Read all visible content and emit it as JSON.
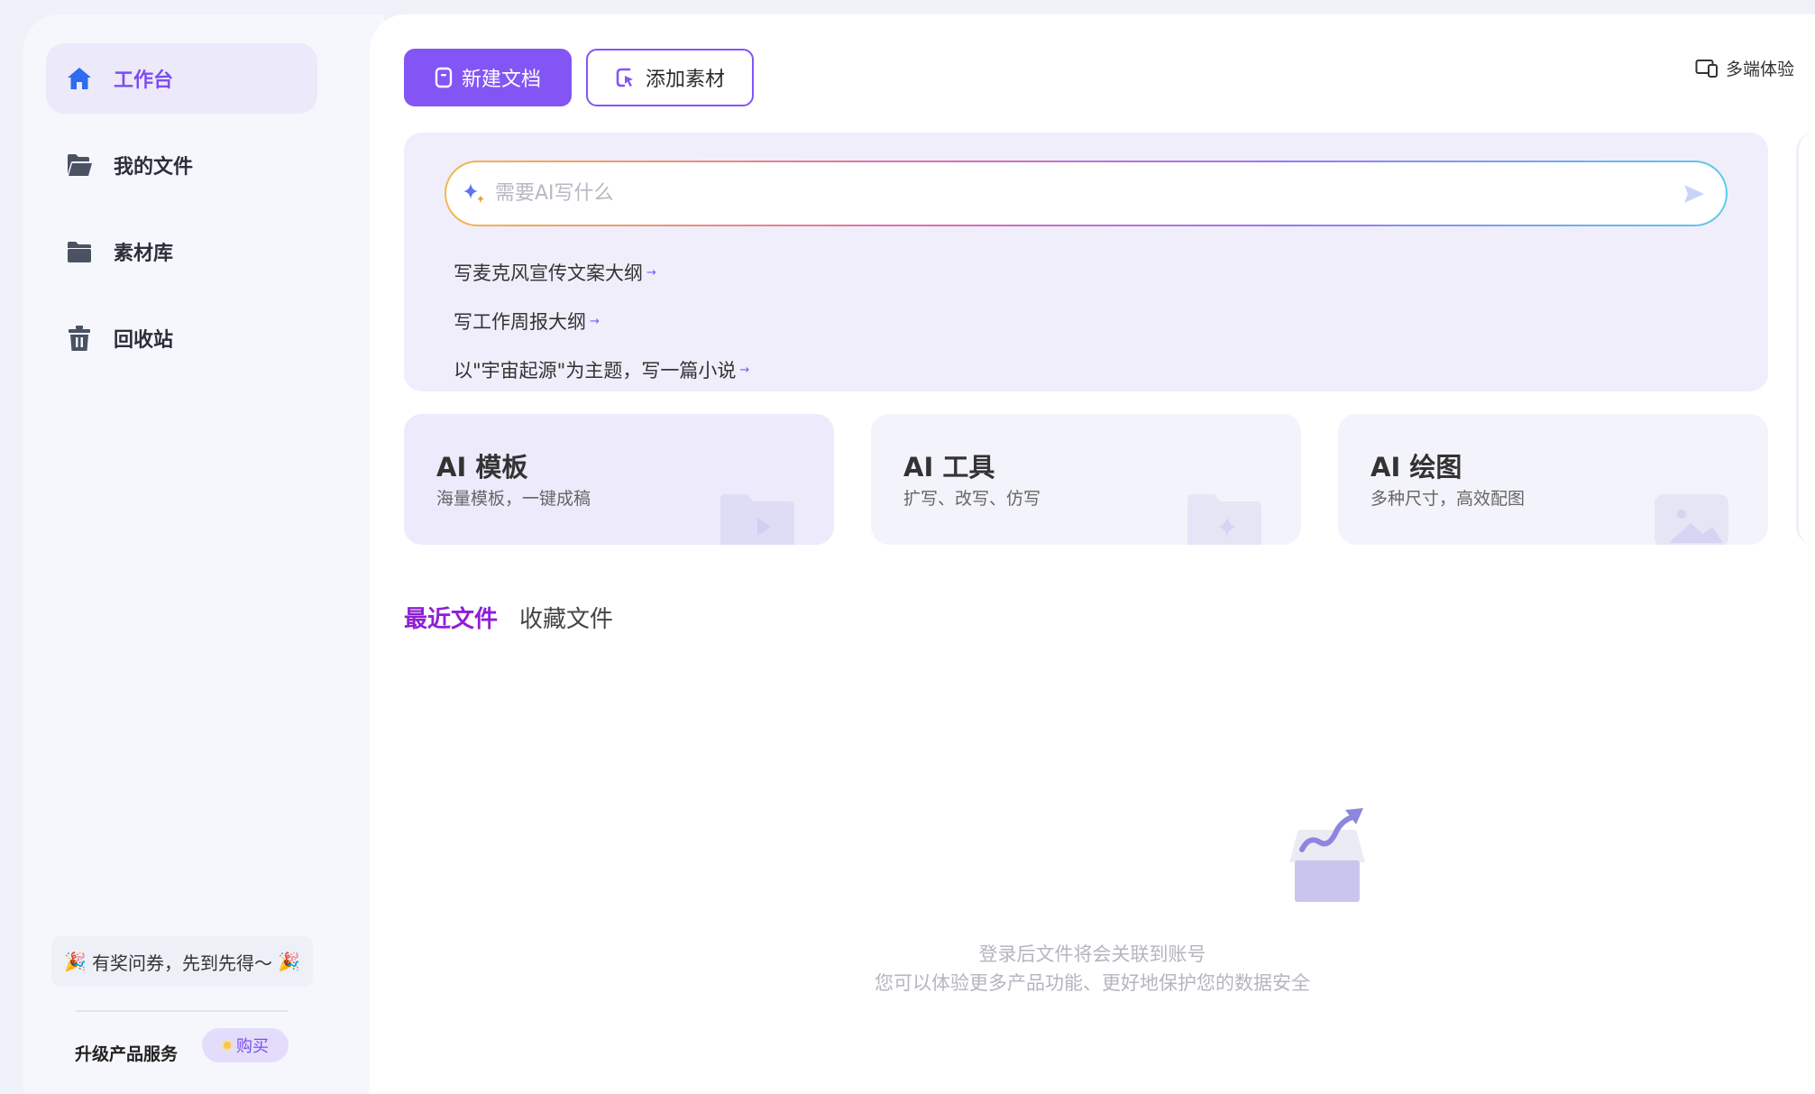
{
  "sidebar": {
    "items": [
      {
        "label": "工作台",
        "icon": "home-icon",
        "active": true
      },
      {
        "label": "我的文件",
        "icon": "folder-open-icon",
        "active": false
      },
      {
        "label": "素材库",
        "icon": "folder-icon",
        "active": false
      },
      {
        "label": "回收站",
        "icon": "trash-icon",
        "active": false
      }
    ],
    "promo_text": "有奖问券，先到先得～",
    "upgrade_label": "升级产品服务",
    "buy_label": "购买"
  },
  "toolbar": {
    "new_doc_label": "新建文档",
    "add_material_label": "添加素材",
    "multi_device_label": "多端体验"
  },
  "ai": {
    "search_placeholder": "需要AI写什么",
    "suggestions": [
      "写麦克风宣传文案大纲",
      "写工作周报大纲",
      "以\"宇宙起源\"为主题，写一篇小说"
    ]
  },
  "cards": [
    {
      "title": "AI 模板",
      "subtitle": "海量模板，一键成稿"
    },
    {
      "title": "AI 工具",
      "subtitle": "扩写、改写、仿写"
    },
    {
      "title": "AI 绘图",
      "subtitle": "多种尺寸，高效配图"
    }
  ],
  "tabs": {
    "recent": "最近文件",
    "favorites": "收藏文件"
  },
  "empty": {
    "line1": "登录后文件将会关联到账号",
    "line2": "您可以体验更多产品功能、更好地保护您的数据安全"
  },
  "colors": {
    "accent": "#8355f5",
    "tab_active": "#8f1ed6",
    "home_icon": "#2f6bf0"
  }
}
